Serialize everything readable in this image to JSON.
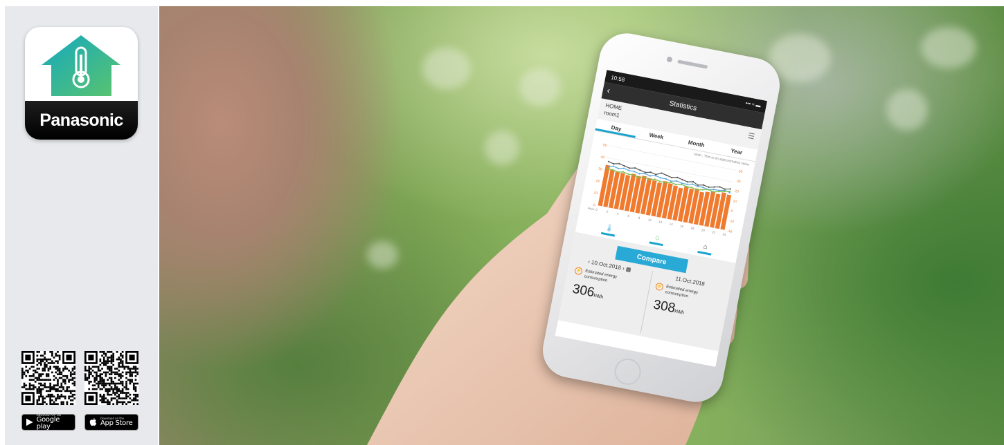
{
  "sidebar": {
    "brand": "Panasonic",
    "app_icon_name": "thermometer-house-icon",
    "qr_codes": [
      "qr-google-play",
      "qr-app-store"
    ],
    "badges": {
      "google_play": {
        "small": "ANDROID APP ON",
        "big": "Google play"
      },
      "app_store": {
        "small": "Download on the",
        "big": "App Store"
      }
    }
  },
  "phone": {
    "status_time": "10:58",
    "status_icons": "••• ≈ ▬",
    "title": "Statistics",
    "home_label": "HOME",
    "room_label": "room1",
    "tabs": [
      "Day",
      "Week",
      "Month",
      "Year"
    ],
    "active_tab": "Day",
    "note": "Note : This is an approximated value",
    "compare_label": "Compare",
    "left_date": "10.Oct.2018",
    "right_date": "11.Oct.2018",
    "energy_label_line1": "Estimated energy",
    "energy_label_line2": "consumption",
    "left_value": "306",
    "right_value": "308",
    "unit": "kWh"
  },
  "chart_data": {
    "type": "bar",
    "categories": [
      "0",
      "1",
      "2",
      "3",
      "4",
      "5",
      "6",
      "7",
      "8",
      "9",
      "10",
      "11",
      "12",
      "13",
      "14",
      "15",
      "16",
      "17",
      "18",
      "19",
      "20",
      "21",
      "22",
      "23"
    ],
    "series": [
      {
        "values": [
          34,
          31,
          30,
          30,
          29,
          31,
          30,
          31,
          30,
          29,
          28,
          30,
          29,
          28,
          27,
          29,
          28,
          29,
          27,
          28,
          29,
          28,
          30,
          29
        ]
      }
    ],
    "x_tick_labels": [
      "Hour",
      "0",
      "2",
      "4",
      "6",
      "8",
      "10",
      "12",
      "14",
      "16",
      "18",
      "20",
      "22",
      "24"
    ],
    "y_left_ticks": [
      "50",
      "40",
      "30",
      "20",
      "10",
      "0"
    ],
    "y_right_ticks": [
      "50",
      "30",
      "20",
      "10",
      "0",
      "-10",
      "-30"
    ],
    "lines": [
      {
        "values": [
          37,
          36,
          37,
          36,
          35,
          36,
          35,
          34,
          35,
          34,
          36,
          35,
          34,
          35,
          34,
          33,
          34,
          32,
          33,
          32,
          33,
          34,
          33,
          34
        ]
      },
      {
        "values": [
          33,
          34,
          33,
          34,
          33,
          33,
          32,
          33,
          32,
          33,
          32,
          32,
          31,
          32,
          31,
          31,
          32,
          31,
          31,
          30,
          31,
          31,
          32,
          31
        ]
      },
      {
        "values": [
          31,
          31,
          30,
          31,
          30,
          30,
          29,
          30,
          29,
          30,
          29,
          29,
          30,
          29,
          30,
          29,
          29,
          28,
          29,
          30,
          29,
          30,
          31,
          32
        ]
      }
    ],
    "ylim": [
      0,
      50
    ],
    "colors": {
      "bars": "#f07a2e",
      "line1": "#555555",
      "line2": "#5aa5d8",
      "line3": "#7cc04c"
    }
  },
  "colors": {
    "accent": "#29aad6",
    "sidebar": "#e8e9ec",
    "icon_teal": "#1fb4b0",
    "icon_green": "#5fc26b"
  }
}
